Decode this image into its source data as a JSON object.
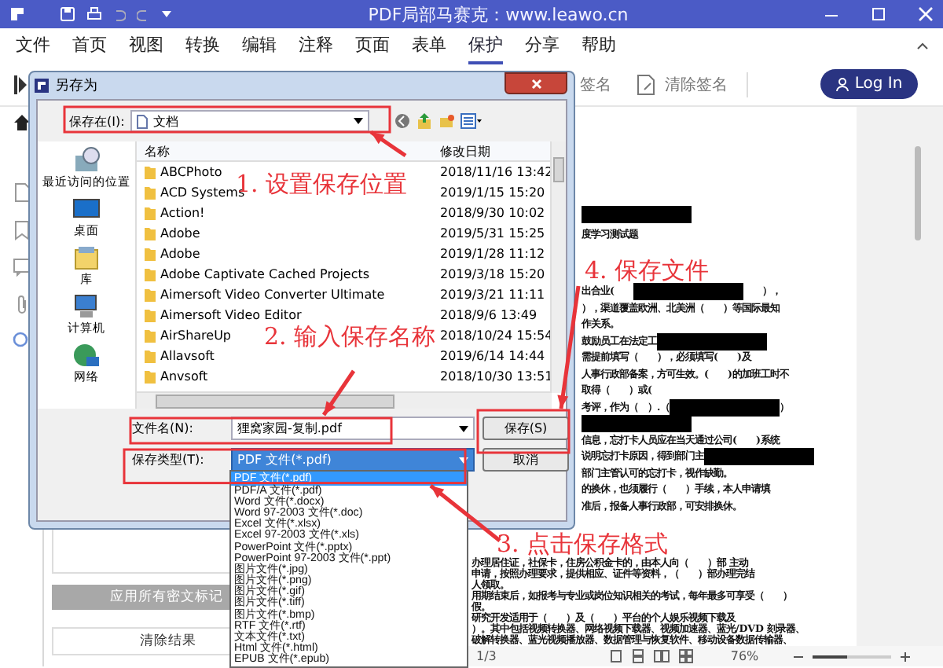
{
  "window": {
    "title": "PDF局部马赛克：www.leawo.cn"
  },
  "menu": [
    {
      "label": "文件",
      "selected": false
    },
    {
      "label": "首页",
      "selected": false
    },
    {
      "label": "视图",
      "selected": false
    },
    {
      "label": "转换",
      "selected": false
    },
    {
      "label": "编辑",
      "selected": false
    },
    {
      "label": "注释",
      "selected": false
    },
    {
      "label": "页面",
      "selected": false
    },
    {
      "label": "表单",
      "selected": false
    },
    {
      "label": "保护",
      "selected": true
    },
    {
      "label": "分享",
      "selected": false
    },
    {
      "label": "帮助",
      "selected": false
    }
  ],
  "toolbar": {
    "items": [
      "签名",
      "清除签名"
    ],
    "login": "Log In"
  },
  "side_panel": {
    "buttons": [
      {
        "label": "应用所有密文标记",
        "disabled": true
      },
      {
        "label": "清除结果",
        "disabled": false
      }
    ]
  },
  "document": {
    "upper_lines": [
      [
        {
          "kind": "redaction"
        }
      ],
      [
        {
          "kind": "text",
          "text": "度学习测试题"
        }
      ],
      [
        {
          "kind": "text",
          "text": "出合业(　　"
        },
        {
          "kind": "redaction"
        },
        {
          "kind": "text",
          "text": "　　），"
        }
      ],
      [
        {
          "kind": "text",
          "text": "），渠道覆盖欧洲、北美洲（　　）等国际最知"
        }
      ],
      [
        {
          "kind": "text",
          "text": "作关系。"
        }
      ],
      [
        {
          "kind": "text",
          "text": "鼓励员工在法定工"
        },
        {
          "kind": "redaction"
        }
      ],
      [
        {
          "kind": "text",
          "text": "需提前填写（　　），必须填写(　　)及"
        }
      ],
      [
        {
          "kind": "text",
          "text": "人事行政部备案，方可生效。(　　)的加班工时不"
        }
      ],
      [
        {
          "kind": "text",
          "text": "取得（　　）或("
        }
      ],
      [
        {
          "kind": "text",
          "text": "考评，作为（　）.（"
        },
        {
          "kind": "redaction"
        },
        {
          "kind": "text",
          "text": "）"
        }
      ],
      [
        {
          "kind": "redaction"
        }
      ],
      [
        {
          "kind": "text",
          "text": "信息，忘打卡人员应在当天通过公司(　　)系统"
        }
      ],
      [
        {
          "kind": "text",
          "text": "说明忘打卡原因，得到部门主"
        },
        {
          "kind": "redaction"
        }
      ],
      [
        {
          "kind": "text",
          "text": "部门主管认可的忘打卡，视作缺勤。"
        }
      ],
      [
        {
          "kind": "text",
          "text": "的换休，也须履行（　　）手续，本人申请填"
        }
      ],
      [
        {
          "kind": "text",
          "text": "准后，报备人事行政部，可安排换休。"
        }
      ]
    ],
    "lower_lines": [
      [
        {
          "kind": "text",
          "text": "办理居住证，社保卡，住房公积金卡的，由本人向（　　）部 主动"
        }
      ],
      [
        {
          "kind": "text",
          "text": "申请，按照办理要求，提供相应、证件等资料，（　　）部办理完结"
        }
      ],
      [
        {
          "kind": "text",
          "text": "人领取。"
        }
      ],
      [
        {
          "kind": "text",
          "text": "用期结束后，如报考与专业或岗位知识相关的考试，每年最多可享受（　　）"
        }
      ],
      [
        {
          "kind": "text",
          "text": "假。"
        }
      ],
      [
        {
          "kind": "text",
          "text": "研究开发适用于（　　）及（　　）平台的个人娱乐视频下载及"
        }
      ],
      [
        {
          "kind": "text",
          "text": "）。其中包括视频转换器、网络视频下载器、视频加速器、蓝光/DVD 刻录器、"
        }
      ],
      [
        {
          "kind": "text",
          "text": "破解转换器、蓝光视频播放器、数据管理与恢复软件、移动设备数据传输器、"
        }
      ]
    ]
  },
  "status_bar": {
    "page": "1/3",
    "zoom": "76%",
    "level": 0.45
  },
  "dialog": {
    "title": "另存为",
    "look_in_label": "保存在(I):",
    "look_in": "文档",
    "places": [
      "最近访问的位置",
      "桌面",
      "库",
      "计算机",
      "网络"
    ],
    "columns": [
      "名称",
      "修改日期"
    ],
    "files": [
      {
        "name": "ABCPhoto",
        "date": "2018/11/16 13:42"
      },
      {
        "name": "ACD Systems",
        "date": "2019/1/15 15:20"
      },
      {
        "name": "Action!",
        "date": "2018/9/30 10:02"
      },
      {
        "name": "Adobe",
        "date": "2019/5/31 15:25"
      },
      {
        "name": "Adobe",
        "date": "2019/1/28 11:12"
      },
      {
        "name": "Adobe Captivate Cached Projects",
        "date": "2019/3/18 15:20"
      },
      {
        "name": "Aimersoft Video Converter Ultimate",
        "date": "2019/3/21 11:11"
      },
      {
        "name": "Aimersoft Video Editor",
        "date": "2018/9/6 13:49"
      },
      {
        "name": "AirShareUp",
        "date": "2018/10/24 15:54"
      },
      {
        "name": "Allavsoft",
        "date": "2019/6/14 14:44"
      },
      {
        "name": "Anvsoft",
        "date": "2018/10/30 13:51"
      }
    ],
    "file_name_label": "文件名(N):",
    "file_name": "狸窝家园-复制.pdf",
    "file_type_label": "保存类型(T):",
    "file_type": "PDF 文件(*.pdf)",
    "file_type_options": [
      {
        "label": "PDF 文件(*.pdf)",
        "selected": true
      },
      {
        "label": "PDF/A 文件(*.pdf)",
        "selected": false
      },
      {
        "label": "Word 文件(*.docx)",
        "selected": false
      },
      {
        "label": "Word 97-2003 文件(*.doc)",
        "selected": false
      },
      {
        "label": "Excel 文件(*.xlsx)",
        "selected": false
      },
      {
        "label": "Excel 97-2003 文件(*.xls)",
        "selected": false
      },
      {
        "label": "PowerPoint 文件(*.pptx)",
        "selected": false
      },
      {
        "label": "PowerPoint 97-2003 文件(*.ppt)",
        "selected": false
      },
      {
        "label": "图片文件(*.jpg)",
        "selected": false
      },
      {
        "label": "图片文件(*.png)",
        "selected": false
      },
      {
        "label": "图片文件(*.gif)",
        "selected": false
      },
      {
        "label": "图片文件(*.tiff)",
        "selected": false
      },
      {
        "label": "图片文件(*.bmp)",
        "selected": false
      },
      {
        "label": "RTF 文件(*.rtf)",
        "selected": false
      },
      {
        "label": "文本文件(*.txt)",
        "selected": false
      },
      {
        "label": "Html 文件(*.html)",
        "selected": false
      },
      {
        "label": "EPUB 文件(*.epub)",
        "selected": false
      }
    ],
    "buttons": [
      "保存(S)",
      "取消"
    ]
  },
  "annotations": [
    "1. 设置保存位置",
    "4. 保存文件",
    "2. 输入保存名称",
    "3. 点击保存格式"
  ]
}
